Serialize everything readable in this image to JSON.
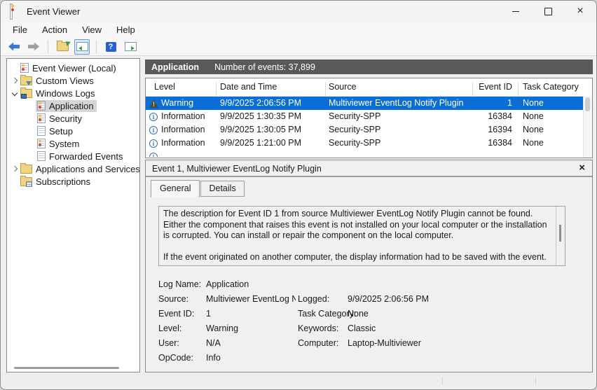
{
  "window": {
    "title": "Event Viewer",
    "titlebar_icons": [
      "event-viewer-app-icon",
      "minimize-icon",
      "maximize-icon",
      "close-icon"
    ]
  },
  "menu": [
    "File",
    "Action",
    "View",
    "Help"
  ],
  "toolbar": {
    "icons": [
      "back-icon",
      "forward-icon",
      "open-saved-log-icon",
      "show-console-tree-icon",
      "help-icon",
      "show-action-pane-icon"
    ]
  },
  "tree": {
    "items": [
      {
        "label": "Event Viewer (Local)",
        "level": 0,
        "icon": "event-viewer-icon",
        "expander": "none",
        "selected": false
      },
      {
        "label": "Custom Views",
        "level": 1,
        "icon": "folder-filter-icon",
        "expander": "collapsed",
        "selected": false
      },
      {
        "label": "Windows Logs",
        "level": 1,
        "icon": "folder-monitor-icon",
        "expander": "expanded",
        "selected": false
      },
      {
        "label": "Application",
        "level": 2,
        "icon": "log-icon",
        "expander": "none",
        "selected": true
      },
      {
        "label": "Security",
        "level": 2,
        "icon": "log-icon",
        "expander": "none",
        "selected": false
      },
      {
        "label": "Setup",
        "level": 2,
        "icon": "page-icon",
        "expander": "none",
        "selected": false
      },
      {
        "label": "System",
        "level": 2,
        "icon": "log-icon",
        "expander": "none",
        "selected": false
      },
      {
        "label": "Forwarded Events",
        "level": 2,
        "icon": "page-icon",
        "expander": "none",
        "selected": false
      },
      {
        "label": "Applications and Services Lo",
        "level": 1,
        "icon": "folder-icon",
        "expander": "collapsed",
        "selected": false
      },
      {
        "label": "Subscriptions",
        "level": 1,
        "icon": "folder-table-icon",
        "expander": "none",
        "selected": false
      }
    ]
  },
  "log_header": {
    "title": "Application",
    "count": "Number of events: 37,899"
  },
  "event_table": {
    "columns": [
      "Level",
      "Date and Time",
      "Source",
      "Event ID",
      "Task Category"
    ],
    "rows": [
      {
        "level": "Warning",
        "datetime": "9/9/2025 2:06:56 PM",
        "source": "Multiviewer EventLog Notify Plugin",
        "event_id": "1",
        "task_category": "None",
        "selected": true
      },
      {
        "level": "Information",
        "datetime": "9/9/2025 1:30:35 PM",
        "source": "Security-SPP",
        "event_id": "16384",
        "task_category": "None",
        "selected": false
      },
      {
        "level": "Information",
        "datetime": "9/9/2025 1:30:05 PM",
        "source": "Security-SPP",
        "event_id": "16394",
        "task_category": "None",
        "selected": false
      },
      {
        "level": "Information",
        "datetime": "9/9/2025 1:21:00 PM",
        "source": "Security-SPP",
        "event_id": "16384",
        "task_category": "None",
        "selected": false
      },
      {
        "level": "Information",
        "partial": true
      }
    ]
  },
  "event_details": {
    "title": "Event 1, Multiviewer EventLog Notify Plugin",
    "tabs": [
      "General",
      "Details"
    ],
    "description_p1": "The description for Event ID 1 from source Multiviewer EventLog Notify Plugin cannot be found. Either the component that raises this event is not installed on your local computer or the installation is corrupted. You can install or repair the component on the local computer.",
    "description_p2": "If the event originated on another computer, the display information had to be saved with the event.",
    "fields": [
      {
        "label": "Log Name:",
        "value": "Application",
        "label2": "",
        "value2": ""
      },
      {
        "label": "Source:",
        "value": "Multiviewer EventLog Notify",
        "label2": "Logged:",
        "value2": "9/9/2025 2:06:56 PM"
      },
      {
        "label": "Event ID:",
        "value": "1",
        "label2": "Task Category:",
        "value2": "None"
      },
      {
        "label": "Level:",
        "value": "Warning",
        "label2": "Keywords:",
        "value2": "Classic"
      },
      {
        "label": "User:",
        "value": "N/A",
        "label2": "Computer:",
        "value2": "Laptop-Multiviewer"
      },
      {
        "label": "OpCode:",
        "value": "Info",
        "label2": "",
        "value2": ""
      }
    ]
  },
  "colors": {
    "accent_selection": "#0a6ed6",
    "log_header_bar": "#595959",
    "warning_triangle": "#43503a",
    "info_circle": "#2a6fc2"
  }
}
